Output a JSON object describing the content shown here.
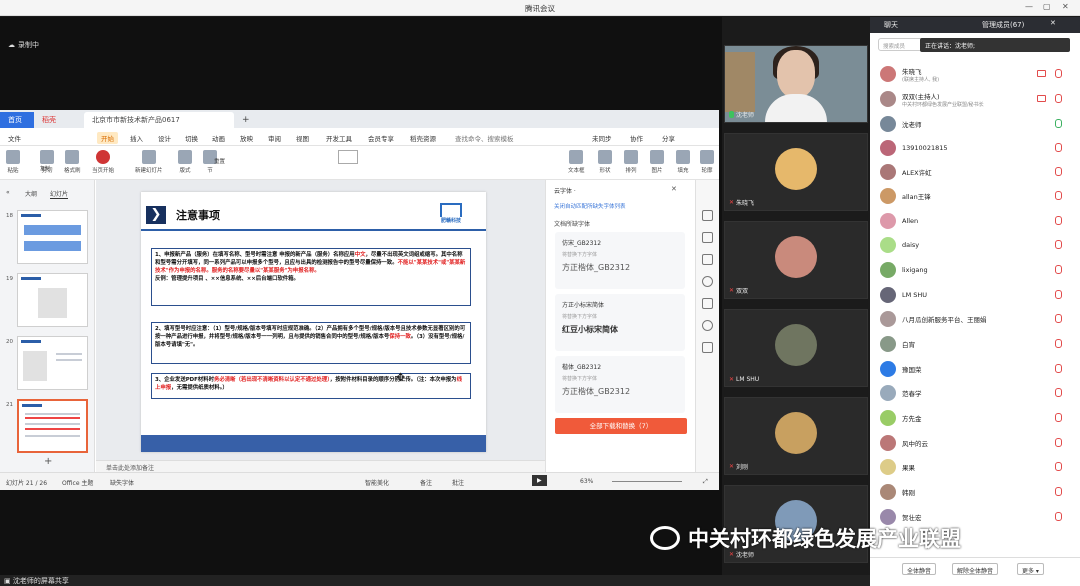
{
  "window": {
    "title": "腾讯会议"
  },
  "recording": {
    "label": "录制中"
  },
  "wps": {
    "tabs": [
      "首页",
      "稻壳",
      "北京市市新技术新产品0617"
    ],
    "menu": [
      "文件",
      "开始",
      "插入",
      "设计",
      "切换",
      "动画",
      "放映",
      "审阅",
      "视图",
      "开发工具",
      "会员专享",
      "稻壳资源",
      "查找命令、搜索模板",
      "未同步",
      "协作",
      "分享"
    ],
    "ribbon": [
      "粘贴",
      "剪切",
      "复制",
      "格式刷",
      "当页开始",
      "新建幻灯片",
      "版式",
      "节",
      "重置",
      "文本框",
      "形状",
      "排列",
      "图片",
      "填充",
      "轮廓"
    ],
    "leftpane": {
      "tabs": [
        "大纲",
        "幻灯片"
      ],
      "thumbs": [
        "18",
        "19",
        "20",
        "21"
      ],
      "add": "+"
    },
    "slide": {
      "title": "注意事项",
      "logo_text": "肥赣科技",
      "p1": [
        "1、申报新产品（服务）在填写名称、型号时需注意 申报的新产品（服务）名称应用",
        "中文",
        "，尽量不出现英文词组或缩写。其中名称和型号需分开填写，同一系列产品可以申报多个型号，且应与出具的检测报告中的型号尽量保持一致。",
        "不能以\"某某技术\"或\"某某新技术\"作为申报的名称。服务的名称要尽量以\"某某服务\"为申报名称。",
        "反例：管理提升项目 、××信息系统、××后台端口软件箱。"
      ],
      "p2": [
        "2、填写型号时应注意：（1）型号/规格/版本号填写时应规范准确。（2）产品拥有多个型号/规格/版本号且技术参数无显著区别的可按一种产品进行申报，并将型号/规格/版本号一一列明，且与提供的销售合同中的型号/规格/版本号",
        "保持一致",
        "。（3）没有型号/规格/版本号请填\"无\"。"
      ],
      "p3": [
        "3、企业发送PDF材料时",
        "务必清晰（若出现不清晰资料以认定不通过处理）",
        "，按附件材料目录的顺序分别上传。（注：本次申报为",
        "线上申报",
        "，无需提供纸质材料。）"
      ],
      "cursor": "✥"
    },
    "rightpane": {
      "title": "云字体 ·",
      "link": "关闭自动匹配所缺失字体列表",
      "section": "文档所缺字体",
      "fonts": [
        {
          "name": "仿宋_GB2312",
          "hint": "将替换下方字体",
          "repl": "方正楷体_GB2312"
        },
        {
          "name": "方正小标宋简体",
          "hint": "将替换下方字体",
          "repl": "红豆小标宋简体"
        },
        {
          "name": "楷体_GB2312",
          "hint": "将替换下方字体",
          "repl": "方正楷体_GB2312"
        }
      ],
      "download": "全部下载和替换（7）"
    },
    "notes": "单击此处添加备注",
    "status": {
      "page": "幻灯片 21 / 26",
      "theme": "Office 主题",
      "missing": "缺失字体",
      "beautify": "智能美化",
      "notes": "备注",
      "comment": "批注",
      "zoom": "63%"
    }
  },
  "videos": [
    {
      "name": "沈老师"
    },
    {
      "name": "朱晓飞"
    },
    {
      "name": "双双"
    },
    {
      "name": "LM SHU"
    },
    {
      "name": "刘刚"
    },
    {
      "name": "沈老师"
    }
  ],
  "chat": {
    "tabs": [
      "聊天",
      "管理成员(67)"
    ],
    "search": "搜索成员",
    "speaking": "正在讲话：沈老师;",
    "members": [
      {
        "name": "朱晓飞",
        "sub": "(联席主持人, 我)"
      },
      {
        "name": "双双(主持人)",
        "sub": "中关村环都绿色发展产业联盟/秘书长"
      },
      {
        "name": "沈老师",
        "sub": ""
      },
      {
        "name": "13910021815",
        "sub": ""
      },
      {
        "name": "ALEX许虹",
        "sub": ""
      },
      {
        "name": "allan王锋",
        "sub": ""
      },
      {
        "name": "Allen",
        "sub": ""
      },
      {
        "name": "daisy",
        "sub": ""
      },
      {
        "name": "lixigang",
        "sub": ""
      },
      {
        "name": "LM SHU",
        "sub": ""
      },
      {
        "name": "八月瓜创新服务平台、王丽娟",
        "sub": ""
      },
      {
        "name": "白宵",
        "sub": ""
      },
      {
        "name": "豫国荣",
        "sub": ""
      },
      {
        "name": "范春学",
        "sub": ""
      },
      {
        "name": "方先金",
        "sub": ""
      },
      {
        "name": "风中的云",
        "sub": ""
      },
      {
        "name": "果果",
        "sub": ""
      },
      {
        "name": "韩刚",
        "sub": ""
      },
      {
        "name": "贺壮宏",
        "sub": ""
      }
    ],
    "footer": [
      "全体静音",
      "解除全体静音",
      "更多 ▾"
    ]
  },
  "bottom": {
    "share": "沈老师的屏幕共享"
  },
  "watermark": "中关村环都绿色发展产业联盟"
}
